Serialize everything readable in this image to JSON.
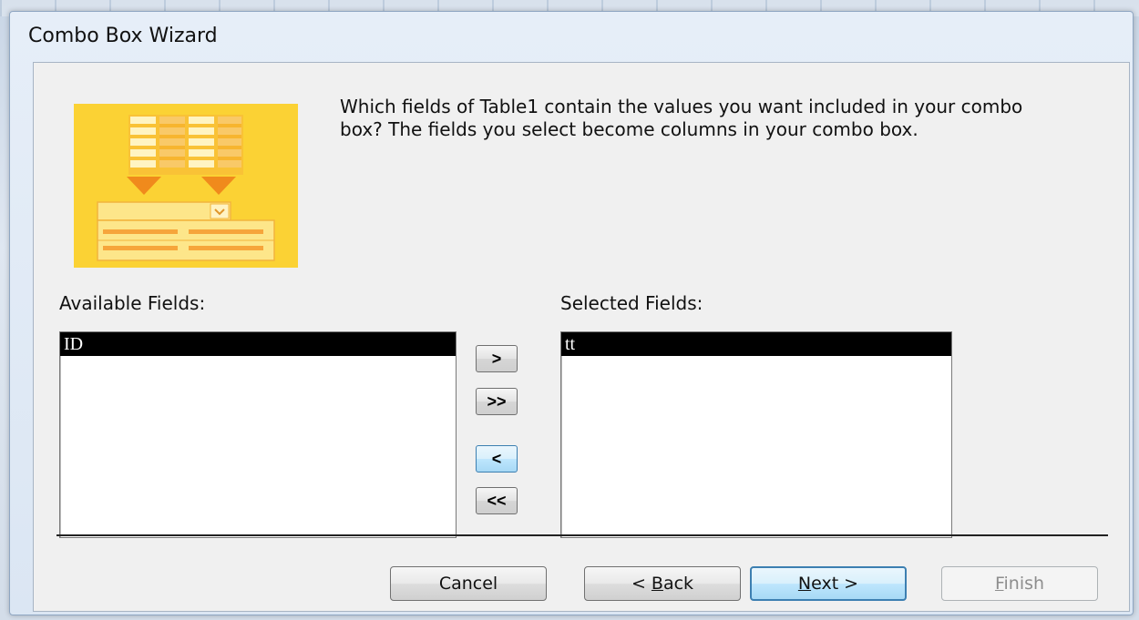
{
  "window": {
    "title": "Combo Box Wizard"
  },
  "instruction": "Which fields of Table1 contain the values you want included in your combo box? The fields you select become columns in your combo box.",
  "available": {
    "label": "Available Fields:",
    "items": [
      "ID"
    ]
  },
  "selected": {
    "label": "Selected Fields:",
    "items": [
      "tt"
    ]
  },
  "move_buttons": {
    "add_one": ">",
    "add_all": ">>",
    "remove_one": "<",
    "remove_all": "<<"
  },
  "buttons": {
    "cancel": "Cancel",
    "back_prefix": "< ",
    "back_accel": "B",
    "back_rest": "ack",
    "next_accel": "N",
    "next_rest": "ext >",
    "finish_accel": "F",
    "finish_rest": "inish"
  },
  "colors": {
    "art_yellow": "#fbd234",
    "art_orange": "#f6a53b",
    "selection": "#000000",
    "default_button_border": "#3c7fb1"
  }
}
